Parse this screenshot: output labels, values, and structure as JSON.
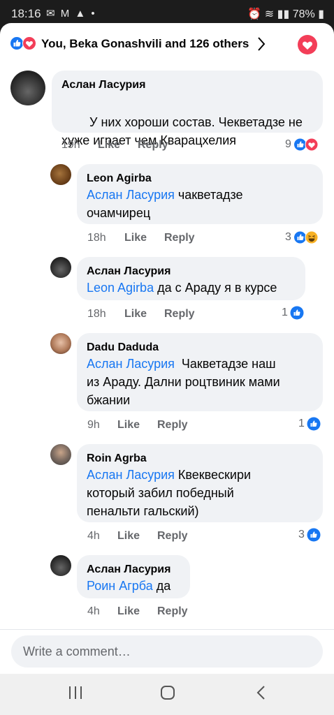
{
  "status": {
    "time": "18:16",
    "battery": "78%"
  },
  "header": {
    "summary": "You, Beka Gonashvili and 126 others"
  },
  "comments": [
    {
      "name": "Аслан Ласурия",
      "mention": "",
      "text": "У них хороши состав. Чекветадзе не\nхуже играет чем Кварацхелия",
      "time": "19h",
      "like": "Like",
      "reply": "Reply",
      "count": "9"
    },
    {
      "name": "Leon Agirba",
      "mention": "Аслан Ласурия",
      "text": " чакветадзе\nочамчирец",
      "time": "18h",
      "like": "Like",
      "reply": "Reply",
      "count": "3"
    },
    {
      "name": "Аслан Ласурия",
      "mention": "Leon Agirba",
      "text": " да с Араду я в курсе",
      "time": "18h",
      "like": "Like",
      "reply": "Reply",
      "count": "1"
    },
    {
      "name": "Dadu  Daduda",
      "mention": "Аслан Ласурия",
      "text": "  Чакветадзе наш\nиз Араду. Дални роцтвиник мами\nбжании",
      "time": "9h",
      "like": "Like",
      "reply": "Reply",
      "count": "1"
    },
    {
      "name": "Roin Agrba",
      "mention": "Аслан Ласурия",
      "text": " Квеквескири\nкоторый забил победный\nпенальти гальский)",
      "time": "4h",
      "like": "Like",
      "reply": "Reply",
      "count": "3"
    },
    {
      "name": "Аслан Ласурия",
      "mention": "Роин Агрба",
      "text": " да",
      "time": "4h",
      "like": "Like",
      "reply": "Reply",
      "count": ""
    }
  ],
  "composer": {
    "placeholder": "Write a comment…"
  },
  "colors": {
    "link": "#1877f2",
    "like_blue": "#1877f2",
    "love_red": "#f33e58",
    "bubble": "#f0f2f5"
  }
}
